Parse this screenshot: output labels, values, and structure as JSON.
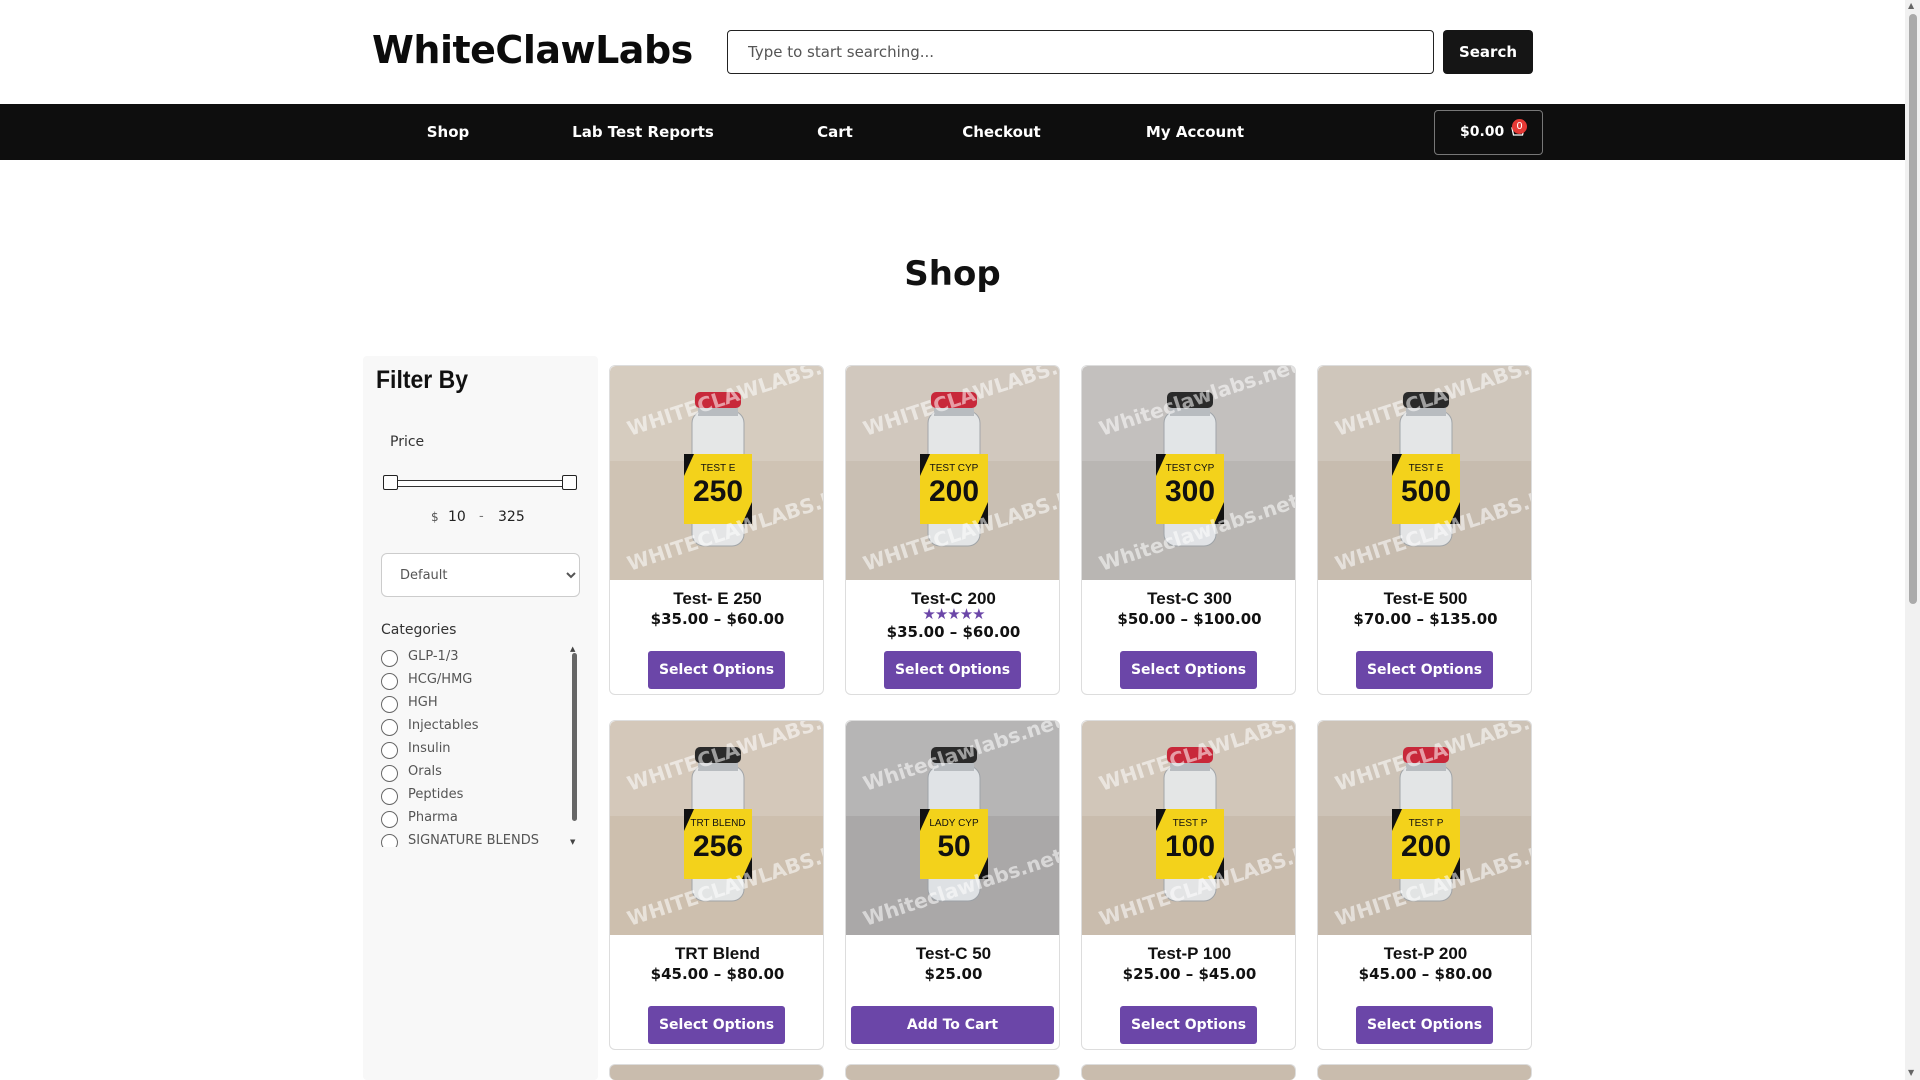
{
  "header": {
    "logo": "WhiteClawLabs",
    "search_placeholder": "Type to start searching...",
    "search_button": "Search"
  },
  "nav": {
    "items": [
      "Shop",
      "Lab Test Reports",
      "Cart",
      "Checkout",
      "My Account"
    ],
    "cart_total": "$0.00",
    "cart_count": "0"
  },
  "page_title": "Shop",
  "sidebar": {
    "title": "Filter By",
    "price_label": "Price",
    "currency": "$",
    "price_min": "10",
    "price_sep": "-",
    "price_max": "325",
    "sort_selected": "Default",
    "categories_label": "Categories",
    "categories": [
      "GLP-1/3",
      "HCG/HMG",
      "HGH",
      "Injectables",
      "Insulin",
      "Orals",
      "Peptides",
      "Pharma",
      "SIGNATURE BLENDS"
    ]
  },
  "products": [
    {
      "name": "Test- E 250",
      "price": "$35.00 – $60.00",
      "button": "Select Options",
      "label_top": "TEST E",
      "label_num": "250",
      "cap": "#c8283a",
      "watermark": "WHITECLAWLABS.NET",
      "rated": false,
      "rating": 0
    },
    {
      "name": "Test-C 200",
      "price": "$35.00 – $60.00",
      "button": "Select Options",
      "label_top": "TEST CYP",
      "label_num": "200",
      "cap": "#c8283a",
      "watermark": "WHITECLAWLABS.NET",
      "rated": true,
      "rating": 5
    },
    {
      "name": "Test-C 300",
      "price": "$50.00 – $100.00",
      "button": "Select Options",
      "label_top": "TEST CYP",
      "label_num": "300",
      "cap": "#2a2a2a",
      "watermark": "Whiteclawlabs.net",
      "rated": false,
      "rating": 0
    },
    {
      "name": "Test-E 500",
      "price": "$70.00 – $135.00",
      "button": "Select Options",
      "label_top": "TEST E",
      "label_num": "500",
      "cap": "#2a2a2a",
      "watermark": "WHITECLAWLABS.NET",
      "rated": false,
      "rating": 0
    },
    {
      "name": "TRT Blend",
      "price": "$45.00 – $80.00",
      "button": "Select Options",
      "label_top": "TRT BLEND",
      "label_num": "256",
      "cap": "#2a2a2a",
      "watermark": "WHITECLAWLABS.NET",
      "rated": false,
      "rating": 0
    },
    {
      "name": "Test-C 50",
      "price": "$25.00",
      "button": "Add To Cart",
      "label_top": "LADY CYP",
      "label_num": "50",
      "cap": "#2a2a2a",
      "watermark": "Whiteclawlabs.net",
      "rated": false,
      "rating": 0
    },
    {
      "name": "Test-P 100",
      "price": "$25.00 – $45.00",
      "button": "Select Options",
      "label_top": "TEST P",
      "label_num": "100",
      "cap": "#c8283a",
      "watermark": "WHITECLAWLABS.NET",
      "rated": false,
      "rating": 0
    },
    {
      "name": "Test-P 200",
      "price": "$45.00 – $80.00",
      "button": "Select Options",
      "label_top": "TEST P",
      "label_num": "200",
      "cap": "#c8283a",
      "watermark": "WHITECLAWLABS.NET",
      "rated": false,
      "rating": 0
    }
  ],
  "colors": {
    "accent": "#6b46a8",
    "nav_bg": "#0e0e0e",
    "label_yellow": "#f3d21b"
  }
}
